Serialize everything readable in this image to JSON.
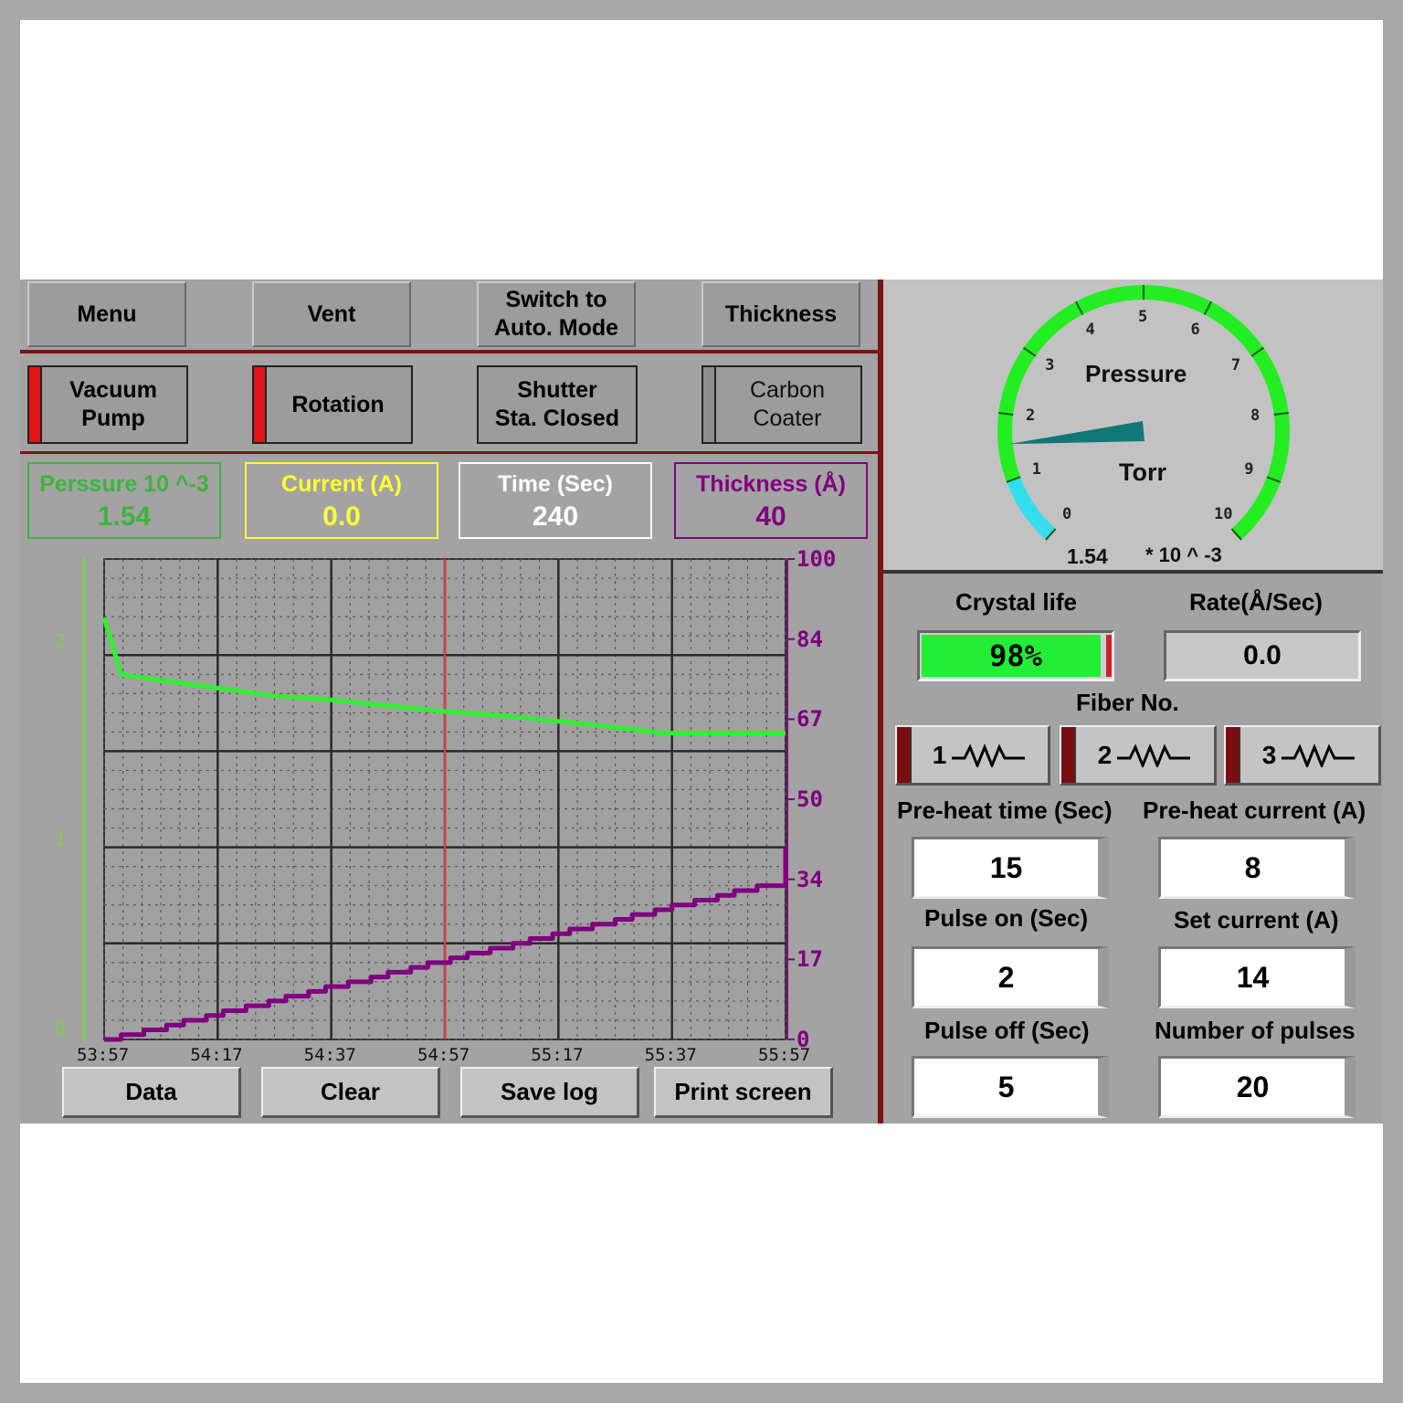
{
  "toolbar": {
    "menu": "Menu",
    "vent": "Vent",
    "auto_mode": "Switch to\nAuto. Mode",
    "thickness": "Thickness"
  },
  "toggles": {
    "vacuum_pump": "Vacuum\nPump",
    "rotation": "Rotation",
    "shutter": "Shutter\nSta. Closed",
    "carbon_coater": "Carbon\nCoater"
  },
  "readouts": {
    "pressure_label": "Perssure 10 ^-3",
    "pressure_value": "1.54",
    "current_label": "Current (A)",
    "current_value": "0.0",
    "time_label": "Time (Sec)",
    "time_value": "240",
    "thickness_label": "Thickness (Å)",
    "thickness_value": "40"
  },
  "colors": {
    "pressure": "#3cb43c",
    "current": "#ffff33",
    "time": "#ffffff",
    "thickness": "#800080",
    "gauge_green": "#22ee22",
    "gauge_cyan": "#33ddee",
    "needle": "#117777"
  },
  "chart_data": {
    "type": "line",
    "x_ticks": [
      "53:57",
      "54:17",
      "54:37",
      "54:57",
      "55:17",
      "55:37",
      "55:57"
    ],
    "y_left_ticks": [
      "2",
      "1",
      "0"
    ],
    "y_left_range": [
      0,
      2
    ],
    "y_right_ticks": [
      "100",
      "84",
      "67",
      "50",
      "34",
      "17",
      "0"
    ],
    "y_right_range": [
      0,
      100
    ],
    "grid": true,
    "cursor_x_seconds": 60,
    "series": [
      {
        "axis": "left",
        "color": "#33ee33",
        "x": [
          0,
          3,
          10,
          20,
          30,
          40,
          50,
          60,
          70,
          80,
          90,
          98,
          110,
          120
        ],
        "values": [
          2.12,
          1.83,
          1.8,
          1.76,
          1.72,
          1.7,
          1.67,
          1.64,
          1.62,
          1.59,
          1.56,
          1.53,
          1.53,
          1.53
        ]
      },
      {
        "axis": "right",
        "color": "#800080",
        "step": true,
        "x": [
          0,
          3,
          7,
          11,
          14,
          18,
          21,
          25,
          29,
          32,
          36,
          39,
          43,
          47,
          50,
          54,
          57,
          61,
          64,
          68,
          72,
          75,
          79,
          82,
          86,
          90,
          93,
          97,
          100,
          104,
          108,
          111,
          115,
          120
        ],
        "values": [
          0,
          1,
          2,
          3,
          4,
          5,
          6,
          7,
          8,
          9,
          10,
          11,
          12,
          13,
          14,
          15,
          16,
          17,
          18,
          19,
          20,
          21,
          22,
          23,
          24,
          25,
          26,
          27,
          28,
          29,
          30,
          31,
          32,
          40
        ]
      }
    ]
  },
  "bottom_buttons": {
    "data": "Data",
    "clear": "Clear",
    "save_log": "Save log",
    "print_screen": "Print screen"
  },
  "gauge": {
    "title": "Pressure",
    "unit": "Torr",
    "value": 1.54,
    "readout": "1.54",
    "exponent": "* 10 ^ -3",
    "scale_min": 0,
    "scale_max": 10,
    "scale_labels": [
      "0",
      "1",
      "2",
      "3",
      "4",
      "5",
      "6",
      "7",
      "8",
      "9",
      "10"
    ]
  },
  "crystal": {
    "label": "Crystal life",
    "percent": 98,
    "percent_text": "98%"
  },
  "rate": {
    "label": "Rate(Å/Sec)",
    "value": "0.0"
  },
  "fiber": {
    "label": "Fiber No.",
    "buttons": [
      "1",
      "2",
      "3"
    ]
  },
  "params": {
    "preheat_time_label": "Pre-heat time (Sec)",
    "preheat_time": "15",
    "preheat_current_label": "Pre-heat current (A)",
    "preheat_current": "8",
    "pulse_on_label": "Pulse on (Sec)",
    "pulse_on": "2",
    "set_current_label": "Set current (A)",
    "set_current": "14",
    "pulse_off_label": "Pulse off (Sec)",
    "pulse_off": "5",
    "num_pulses_label": "Number of pulses",
    "num_pulses": "20"
  }
}
